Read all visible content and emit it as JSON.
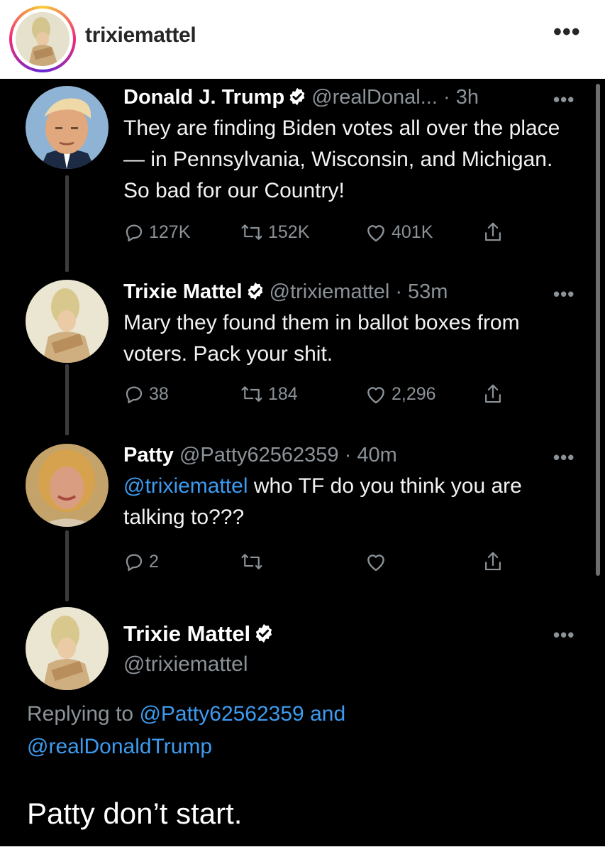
{
  "instagram": {
    "username": "trixiemattel",
    "more_label": "•••"
  },
  "tweets": [
    {
      "name": "Donald J. Trump",
      "handle": "@realDonal...",
      "time": "· 3h",
      "text": "They are finding Biden votes all over the place — in Pennsylvania, Wisconsin, and Michigan. So bad for our Country!",
      "replies": "127K",
      "retweets": "152K",
      "likes": "401K"
    },
    {
      "name": "Trixie Mattel",
      "handle": "@trixiemattel",
      "time": "· 53m",
      "text": "Mary they found them in ballot boxes from voters. Pack your shit.",
      "replies": "38",
      "retweets": "184",
      "likes": "2,296"
    },
    {
      "name": "Patty",
      "handle": "@Patty62562359",
      "time": "· 40m",
      "mention": "@trixiemattel",
      "text": " who TF do you think you are talking to???",
      "replies": "2",
      "retweets": "",
      "likes": ""
    }
  ],
  "main_tweet": {
    "name": "Trixie Mattel",
    "handle": "@trixiemattel",
    "replying_prefix": "Replying to ",
    "replying_user1": "@Patty62562359",
    "replying_and": " and",
    "replying_user2": "@realDonaldTrump",
    "text": "Patty don’t start."
  },
  "colors": {
    "background": "#000000",
    "link": "#3d9bf0",
    "secondary_text": "#8b9298",
    "verified": "#ffffff"
  }
}
